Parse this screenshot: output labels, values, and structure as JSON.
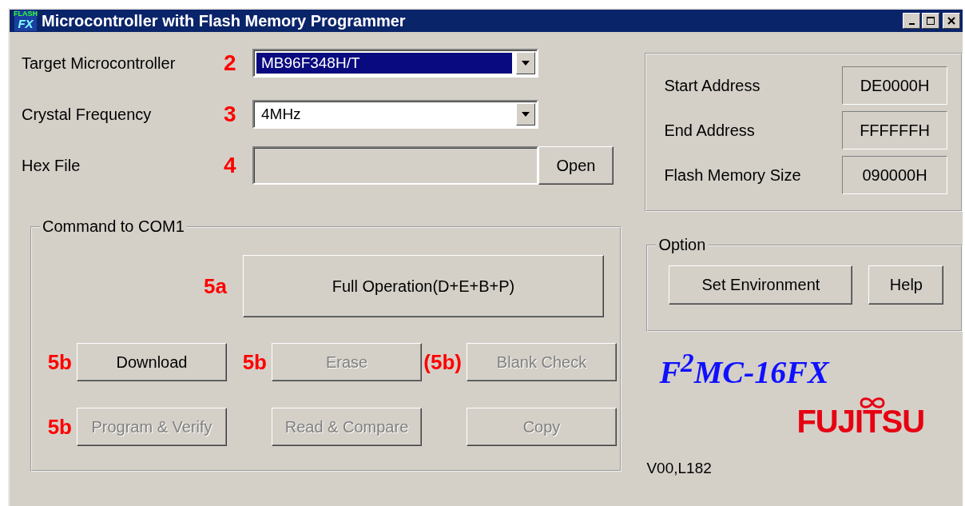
{
  "window": {
    "title": "Microcontroller with Flash Memory Programmer",
    "icon_text": [
      "FLASH",
      "FX"
    ]
  },
  "fields": [
    {
      "label": "Target Microcontroller",
      "annotation": "2",
      "kind": "combo",
      "value": "MB96F348H/T",
      "focused": true
    },
    {
      "label": "Crystal Frequency",
      "annotation": "3",
      "kind": "combo",
      "value": "4MHz",
      "focused": false
    },
    {
      "label": "Hex File",
      "annotation": "4",
      "kind": "file",
      "disabled": true,
      "button": "Open"
    }
  ],
  "command_group": {
    "title": "Command to COM1",
    "primary": {
      "label": "Full Operation(D+E+B+P)",
      "annotation": "5a",
      "disabled": false
    },
    "buttons": [
      {
        "label": "Download",
        "annotation": "5b",
        "disabled": false
      },
      {
        "label": "Erase",
        "annotation": "5b",
        "disabled": true
      },
      {
        "label": "Blank Check",
        "annotation": "(5b)",
        "disabled": true
      },
      {
        "label": "Program & Verify",
        "annotation": "5b",
        "disabled": true
      },
      {
        "label": "Read & Compare",
        "disabled": true
      },
      {
        "label": "Copy",
        "disabled": true
      }
    ]
  },
  "memory_info": [
    {
      "label": "Start Address",
      "value": "DE0000H"
    },
    {
      "label": "End Address",
      "value": "FFFFFFH"
    },
    {
      "label": "Flash Memory Size",
      "value": "090000H"
    }
  ],
  "option_group": {
    "title": "Option",
    "buttons": [
      {
        "label": "Set Environment"
      },
      {
        "label": "Help"
      }
    ]
  },
  "product": "F$^{2}$MC-16FX",
  "brand": "FUJITSU",
  "version": "V00,L182"
}
